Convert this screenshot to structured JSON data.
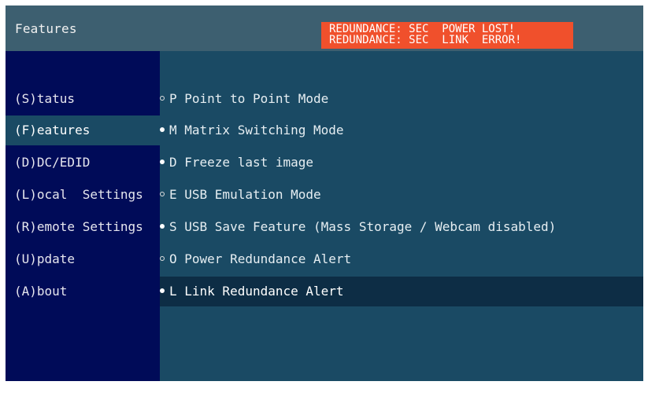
{
  "header": {
    "title": "Features",
    "alerts": [
      "REDUNDANCE: SEC  POWER LOST!",
      "REDUNDANCE: SEC  LINK  ERROR!"
    ]
  },
  "colors": {
    "alert_bg": "#f0502c",
    "sidebar_bg": "#000b58",
    "content_bg": "#1a4a64",
    "highlight_bg": "#0d2d45"
  },
  "sidebar": {
    "items": [
      {
        "label": "(S)tatus"
      },
      {
        "label": "(F)eatures",
        "active": true
      },
      {
        "label": "(D)DC/EDID"
      },
      {
        "label": "(L)ocal  Settings"
      },
      {
        "label": "(R)emote Settings"
      },
      {
        "label": "(U)pdate"
      },
      {
        "label": "(A)bout"
      }
    ]
  },
  "features": [
    {
      "key": "P",
      "text": "P Point to Point Mode",
      "enabled": false
    },
    {
      "key": "M",
      "text": "M Matrix Switching Mode",
      "enabled": true
    },
    {
      "key": "D",
      "text": "D Freeze last image",
      "enabled": true
    },
    {
      "key": "E",
      "text": "E USB Emulation Mode",
      "enabled": false
    },
    {
      "key": "S",
      "text": "S USB Save Feature (Mass Storage / Webcam disabled)",
      "enabled": true
    },
    {
      "key": "O",
      "text": "O Power Redundance Alert",
      "enabled": false
    },
    {
      "key": "L",
      "text": "L Link Redundance Alert",
      "enabled": true,
      "selected": true
    }
  ]
}
